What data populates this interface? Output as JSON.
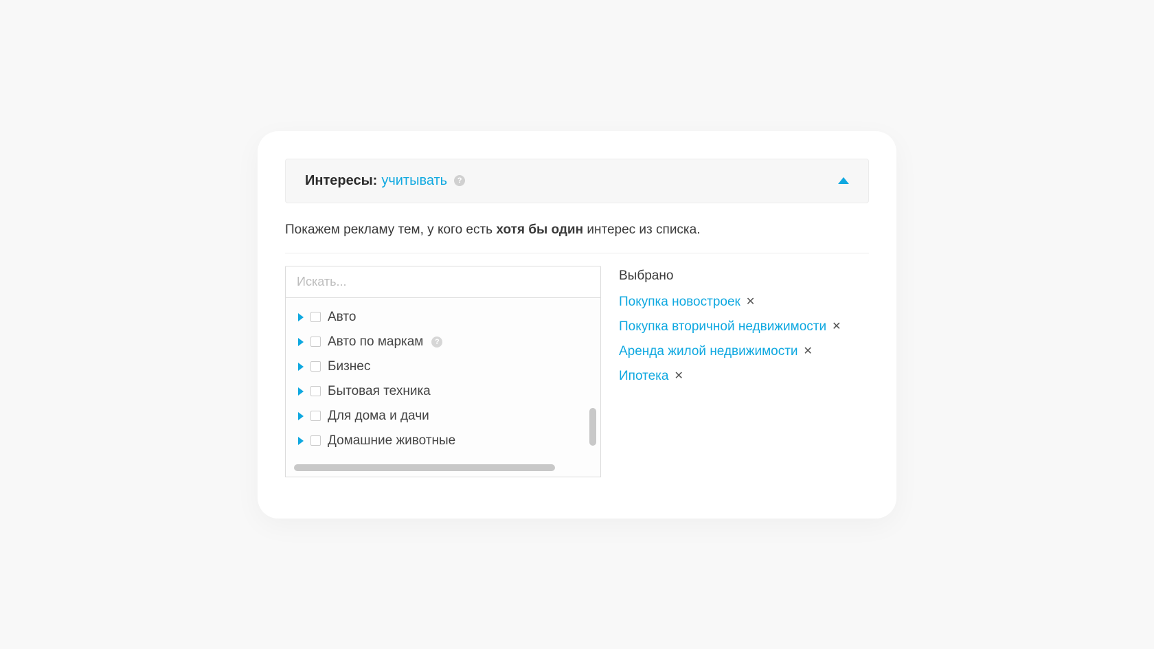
{
  "header": {
    "label": "Интересы:",
    "link": "учитывать",
    "help_glyph": "?"
  },
  "description": {
    "pre": "Покажем рекламу тем, у кого есть ",
    "strong": "хотя бы один",
    "post": " интерес из списка."
  },
  "search": {
    "placeholder": "Искать..."
  },
  "tree": {
    "items": [
      {
        "label": "Авто",
        "help": false
      },
      {
        "label": "Авто по маркам",
        "help": true
      },
      {
        "label": "Бизнес",
        "help": false
      },
      {
        "label": "Бытовая техника",
        "help": false
      },
      {
        "label": "Для дома и дачи",
        "help": false
      },
      {
        "label": "Домашние животные",
        "help": false
      }
    ]
  },
  "selected": {
    "title": "Выбрано",
    "items": [
      {
        "label": "Покупка новостроек"
      },
      {
        "label": "Покупка вторичной недвижимости"
      },
      {
        "label": "Аренда жилой недвижимости"
      },
      {
        "label": "Ипотека"
      }
    ],
    "remove_glyph": "✕"
  }
}
